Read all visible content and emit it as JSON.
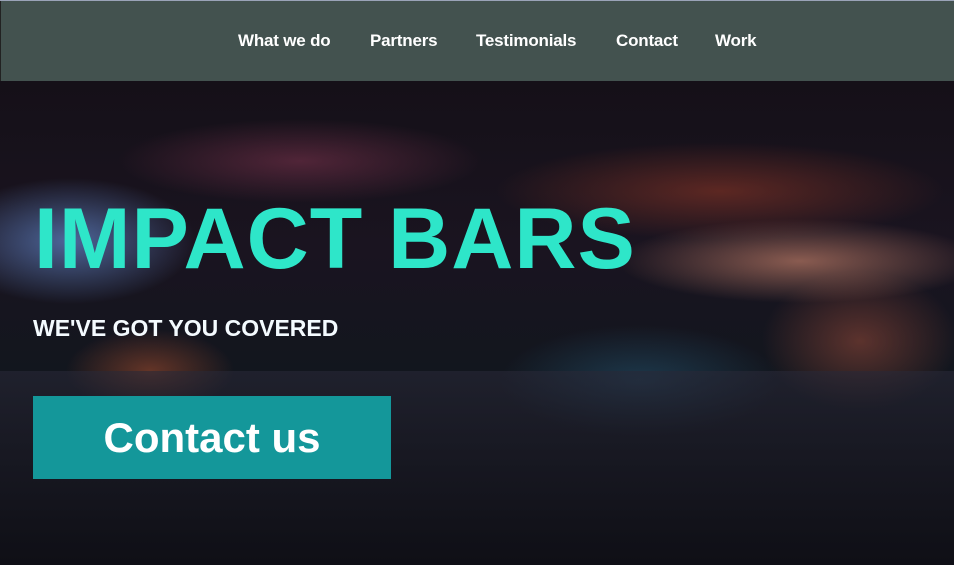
{
  "nav": {
    "items": [
      {
        "label": "What we do"
      },
      {
        "label": "Partners"
      },
      {
        "label": "Testimonials"
      },
      {
        "label": "Contact"
      },
      {
        "label": "Work"
      }
    ]
  },
  "hero": {
    "title": "IMPACT BARS",
    "subtitle": "WE'VE GOT YOU COVERED",
    "cta_label": "Contact us"
  },
  "colors": {
    "nav_background": "#43524f",
    "title": "#2ee6c9",
    "cta_background": "#14979a"
  }
}
